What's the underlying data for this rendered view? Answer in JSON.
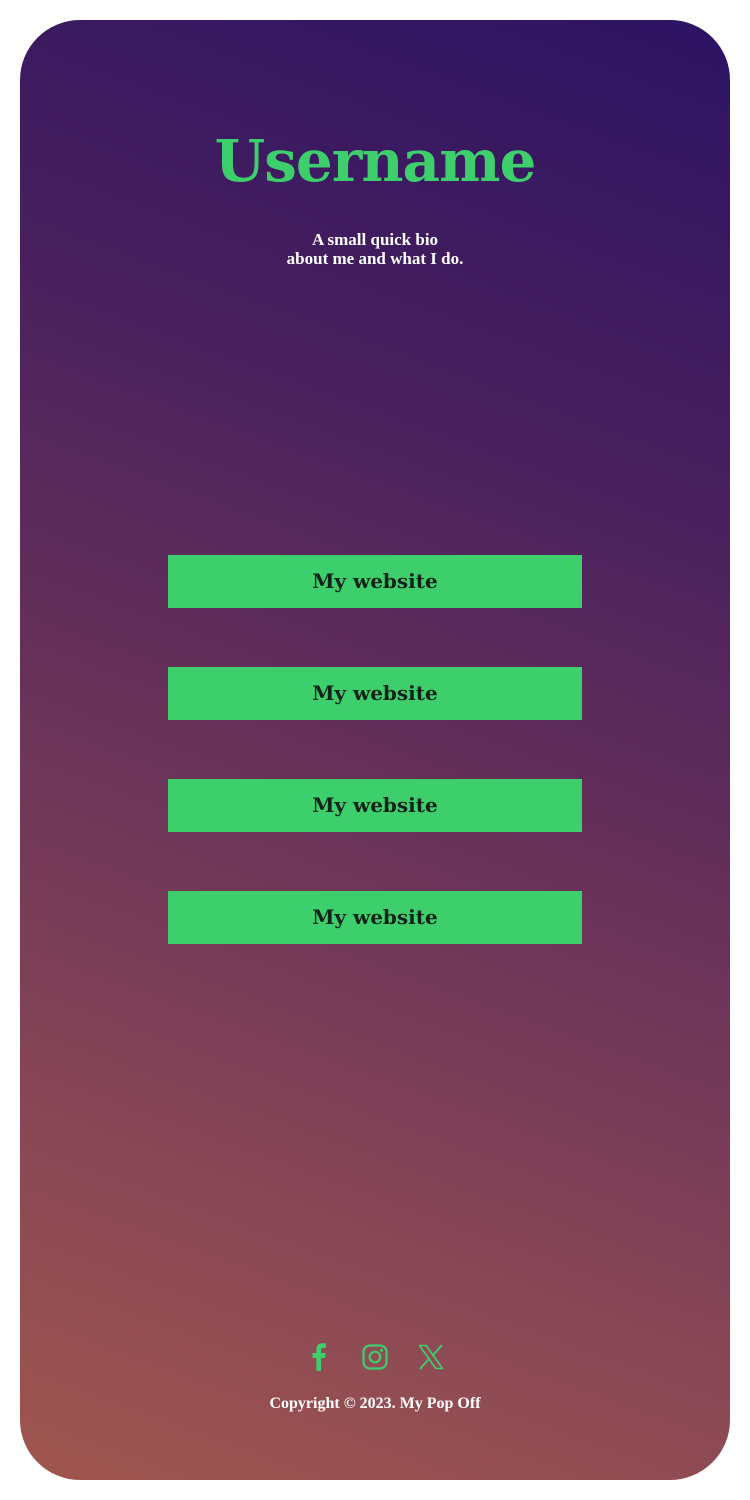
{
  "profile": {
    "username": "Username",
    "bio_line1": "A small quick bio",
    "bio_line2": "about me and what I do."
  },
  "links": [
    {
      "label": "My website"
    },
    {
      "label": "My website"
    },
    {
      "label": "My website"
    },
    {
      "label": "My website"
    }
  ],
  "socials": [
    {
      "icon": "facebook-icon"
    },
    {
      "icon": "instagram-icon"
    },
    {
      "icon": "x-icon"
    }
  ],
  "footer": {
    "copyright": "Copyright © 2023. My Pop Off"
  },
  "colors": {
    "accent": "#3ecf6d",
    "gradient_top": "#2c1363",
    "gradient_bottom": "#a0564e",
    "text_light": "#ffffff"
  }
}
